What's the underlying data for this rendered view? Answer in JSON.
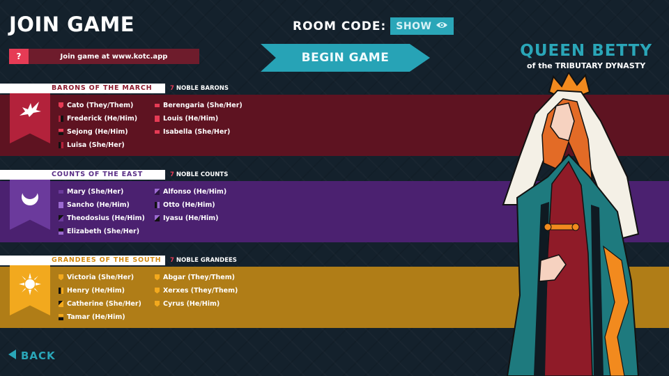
{
  "header": {
    "title": "JOIN GAME",
    "room_code_label": "ROOM CODE:",
    "show_label": "SHOW",
    "join_prefix": "?",
    "join_text": "Join game at www.kotc.app",
    "begin_label": "BEGIN GAME"
  },
  "queen": {
    "name": "QUEEN BETTY",
    "subtitle": "of the TRIBUTARY DYNASTY"
  },
  "factions": [
    {
      "name": "BARONS OF THE MARCH",
      "count": "7",
      "count_label": "NOBLE BARONS",
      "color": "#5e1321",
      "banner_color": "#b3223b",
      "header_text_color": "#8b1a2e",
      "icon": "dragon-icon",
      "players": [
        "Cato (They/Them)",
        "Berengaria (She/Her)",
        "Frederick (He/Him)",
        "Louis (He/Him)",
        "Sejong (He/Him)",
        "Isabella (She/Her)",
        "Luisa (She/Her)"
      ]
    },
    {
      "name": "COUNTS OF THE EAST",
      "count": "7",
      "count_label": "NOBLE COUNTS",
      "color": "#4b2170",
      "banner_color": "#6b3a9c",
      "header_text_color": "#5a2e86",
      "icon": "crescent-moon-icon",
      "players": [
        "Mary (She/Her)",
        "Alfonso (He/Him)",
        "Sancho (He/Him)",
        "Otto (He/Him)",
        "Theodosius (He/Him)",
        "Iyasu (He/Him)",
        "Elizabeth (She/Her)"
      ]
    },
    {
      "name": "GRANDEES OF THE SOUTH",
      "count": "7",
      "count_label": "NOBLE GRANDEES",
      "color": "#b07d17",
      "banner_color": "#f2a91e",
      "header_text_color": "#d48b12",
      "icon": "sun-icon",
      "players": [
        "Victoria (She/Her)",
        "Abgar (They/Them)",
        "Henry (He/Him)",
        "Xerxes (They/Them)",
        "Catherine (She/Her)",
        "Cyrus (He/Him)",
        "Tamar (He/Him)"
      ]
    }
  ],
  "footer": {
    "back_label": "BACK"
  }
}
